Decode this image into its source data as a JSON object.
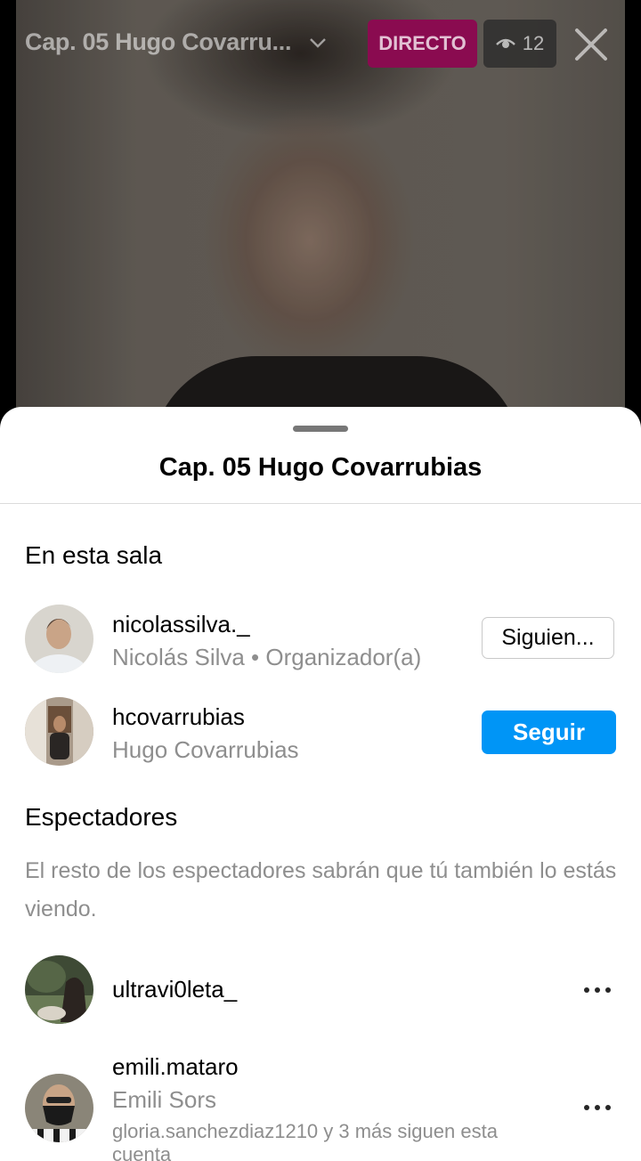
{
  "live": {
    "title": "Cap. 05 Hugo Covarru...",
    "badge": "DIRECTO",
    "viewer_count": "12"
  },
  "sheet": {
    "title": "Cap. 05 Hugo Covarrubias",
    "room_heading": "En esta sala",
    "room_members": [
      {
        "username": "nicolassilva._",
        "subtitle": "Nicolás Silva • Organizador(a)",
        "action": "Siguien..."
      },
      {
        "username": "hcovarrubias",
        "subtitle": "Hugo Covarrubias",
        "action": "Seguir"
      }
    ],
    "viewers_heading": "Espectadores",
    "viewers_description": "El resto de los espectadores sabrán que tú también lo estás viendo.",
    "viewers": [
      {
        "username": "ultravi0leta_"
      },
      {
        "username": "emili.mataro",
        "subtitle": "Emili Sors",
        "mutual": "gloria.sanchezdiaz1210 y 3 más siguen esta cuenta"
      }
    ]
  },
  "colors": {
    "live_badge": "#8a0b50",
    "follow_button": "#0095f6",
    "secondary_text": "#8e8e8e"
  }
}
